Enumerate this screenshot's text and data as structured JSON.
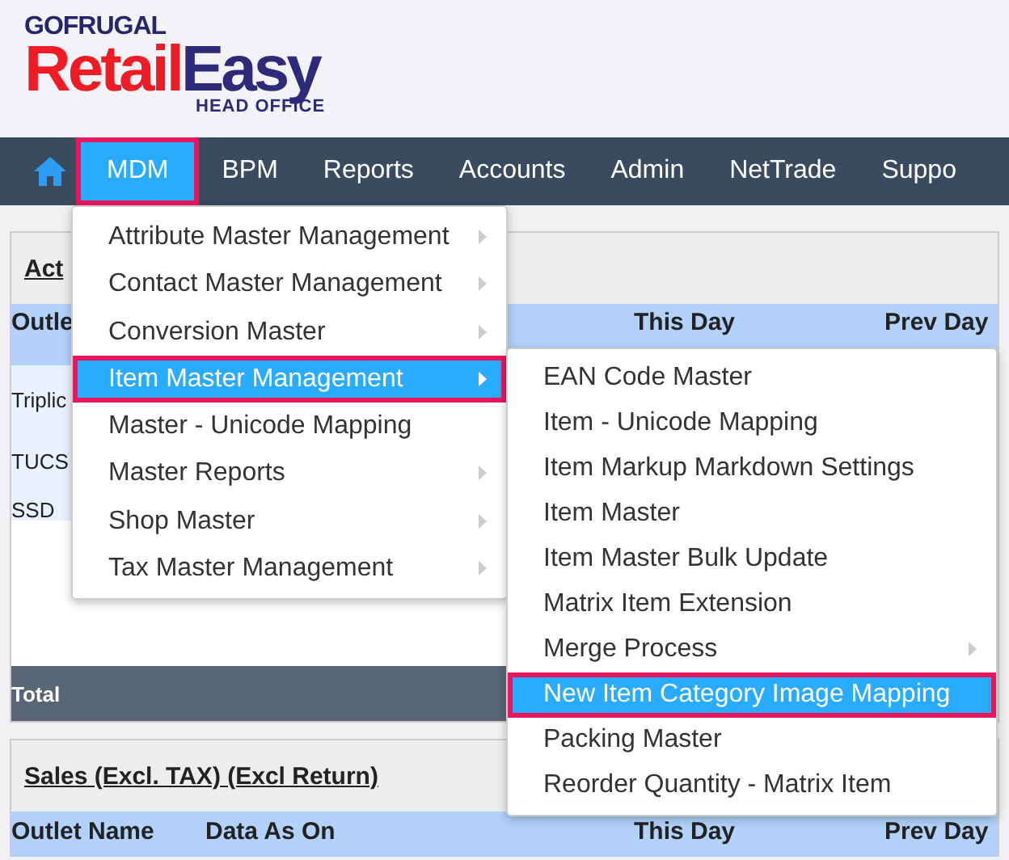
{
  "logo": {
    "brand": "GOFRUGAL",
    "name_first": "Retail",
    "name_second": "Easy",
    "subtitle": "HEAD OFFICE"
  },
  "nav": [
    {
      "label": "MDM",
      "selected": true
    },
    {
      "label": "BPM",
      "selected": false
    },
    {
      "label": "Reports",
      "selected": false
    },
    {
      "label": "Accounts",
      "selected": false
    },
    {
      "label": "Admin",
      "selected": false
    },
    {
      "label": "NetTrade",
      "selected": false
    },
    {
      "label": "Suppo",
      "selected": false
    }
  ],
  "panels": [
    {
      "title": "Act",
      "columns": [
        "Outle",
        "",
        "This Day",
        "Prev Day"
      ],
      "rows": [
        "Triplic",
        "TUCS",
        "SSD"
      ],
      "total": "Total"
    },
    {
      "title": "Sales (Excl. TAX) (Excl Return)",
      "columns": [
        "Outlet Name",
        "Data As On",
        "This Day",
        "Prev Day"
      ]
    }
  ],
  "menu": [
    {
      "label": "Attribute Master Management",
      "has_submenu": true,
      "selected": false
    },
    {
      "label": "Contact Master Management",
      "has_submenu": true,
      "selected": false
    },
    {
      "label": "Conversion Master",
      "has_submenu": true,
      "selected": false
    },
    {
      "label": "Item Master Management",
      "has_submenu": true,
      "selected": true
    },
    {
      "label": "Master - Unicode Mapping",
      "has_submenu": false,
      "selected": false
    },
    {
      "label": "Master Reports",
      "has_submenu": true,
      "selected": false
    },
    {
      "label": "Shop Master",
      "has_submenu": true,
      "selected": false
    },
    {
      "label": "Tax Master Management",
      "has_submenu": true,
      "selected": false
    }
  ],
  "submenu": [
    {
      "label": "EAN Code Master",
      "has_submenu": false,
      "selected": false
    },
    {
      "label": "Item - Unicode Mapping",
      "has_submenu": false,
      "selected": false
    },
    {
      "label": "Item Markup Markdown Settings",
      "has_submenu": false,
      "selected": false
    },
    {
      "label": "Item Master",
      "has_submenu": false,
      "selected": false
    },
    {
      "label": "Item Master Bulk Update",
      "has_submenu": false,
      "selected": false
    },
    {
      "label": "Matrix Item Extension",
      "has_submenu": false,
      "selected": false
    },
    {
      "label": "Merge Process",
      "has_submenu": true,
      "selected": false
    },
    {
      "label": "New Item Category Image Mapping",
      "has_submenu": false,
      "selected": true
    },
    {
      "label": "Packing Master",
      "has_submenu": false,
      "selected": false
    },
    {
      "label": "Reorder Quantity - Matrix Item",
      "has_submenu": false,
      "selected": false
    }
  ]
}
